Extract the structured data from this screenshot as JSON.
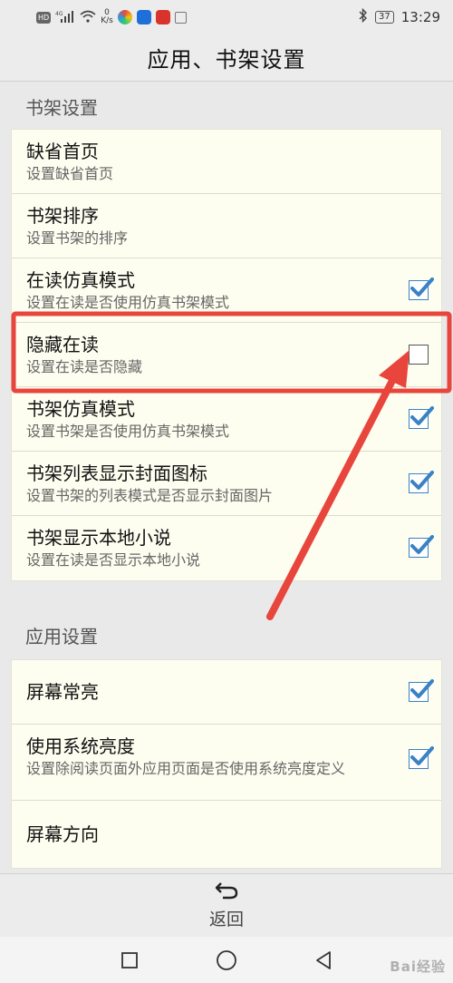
{
  "status_bar": {
    "network_chip": "HD",
    "signal_label": "4G",
    "speed_value": "0",
    "speed_unit": "K/s",
    "time": "13:29",
    "battery": "37"
  },
  "header": {
    "title": "应用、书架设置"
  },
  "sections": {
    "bookshelf": {
      "header": "书架设置",
      "items": [
        {
          "title": "缺省首页",
          "subtitle": "设置缺省首页"
        },
        {
          "title": "书架排序",
          "subtitle": "设置书架的排序"
        },
        {
          "title": "在读仿真模式",
          "subtitle": "设置在读是否使用仿真书架模式",
          "checked": true
        },
        {
          "title": "隐藏在读",
          "subtitle": "设置在读是否隐藏",
          "checked": false
        },
        {
          "title": "书架仿真模式",
          "subtitle": "设置书架是否使用仿真书架模式",
          "checked": true
        },
        {
          "title": "书架列表显示封面图标",
          "subtitle": "设置书架的列表模式是否显示封面图片",
          "checked": true
        },
        {
          "title": "书架显示本地小说",
          "subtitle": "设置在读是否显示本地小说",
          "checked": true
        }
      ]
    },
    "app": {
      "header": "应用设置",
      "items": [
        {
          "title": "屏幕常亮",
          "checked": true
        },
        {
          "title": "使用系统亮度",
          "subtitle": "设置除阅读页面外应用页面是否使用系统亮度定义",
          "checked": true
        },
        {
          "title": "屏幕方向"
        }
      ]
    }
  },
  "footer": {
    "back_label": "返回"
  },
  "watermark": "Bai经验",
  "colors": {
    "accent_check": "#3a82c4",
    "highlight": "#e8453c",
    "card_bg": "#fdfdf0"
  },
  "icons": [
    "back-arrow-icon",
    "checkmark-icon",
    "nav-square-icon",
    "nav-circle-icon",
    "nav-triangle-icon",
    "bluetooth-icon",
    "battery-icon",
    "wifi-icon",
    "signal-icon"
  ]
}
